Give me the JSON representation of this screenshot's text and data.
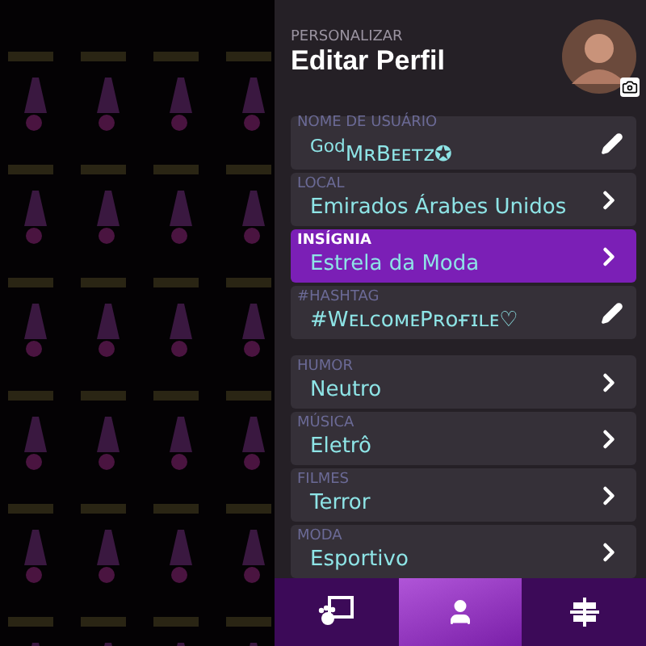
{
  "header": {
    "overline": "PERSONALIZAR",
    "title": "Editar Perfil"
  },
  "groups": [
    {
      "rows": [
        {
          "label": "NOME DE USUÁRIO",
          "value": "$^{God}$MʀBᴇᴇᴛᴢ✪",
          "kind": "edit",
          "selected": false
        },
        {
          "label": "LOCAL",
          "value": "Emirados Árabes Unidos",
          "kind": "link",
          "selected": false
        },
        {
          "label": "INSÍGNIA",
          "value": "Estrela da Moda",
          "kind": "link",
          "selected": true
        },
        {
          "label": "#HASHTAG",
          "value": "#WᴇʟᴄᴏᴍᴇPʀᴏғɪʟᴇ♡",
          "kind": "edit",
          "selected": false
        }
      ]
    },
    {
      "rows": [
        {
          "label": "HUMOR",
          "value": "Neutro",
          "kind": "link",
          "selected": false
        },
        {
          "label": "MÚSICA",
          "value": "Eletrô",
          "kind": "link",
          "selected": false
        },
        {
          "label": "FILMES",
          "value": "Terror",
          "kind": "link",
          "selected": false
        },
        {
          "label": "MODA",
          "value": "Esportivo",
          "kind": "link",
          "selected": false
        }
      ]
    }
  ],
  "nav": [
    {
      "kind": "gallery",
      "selected": false
    },
    {
      "kind": "profile",
      "selected": true
    },
    {
      "kind": "layout",
      "selected": false
    }
  ]
}
